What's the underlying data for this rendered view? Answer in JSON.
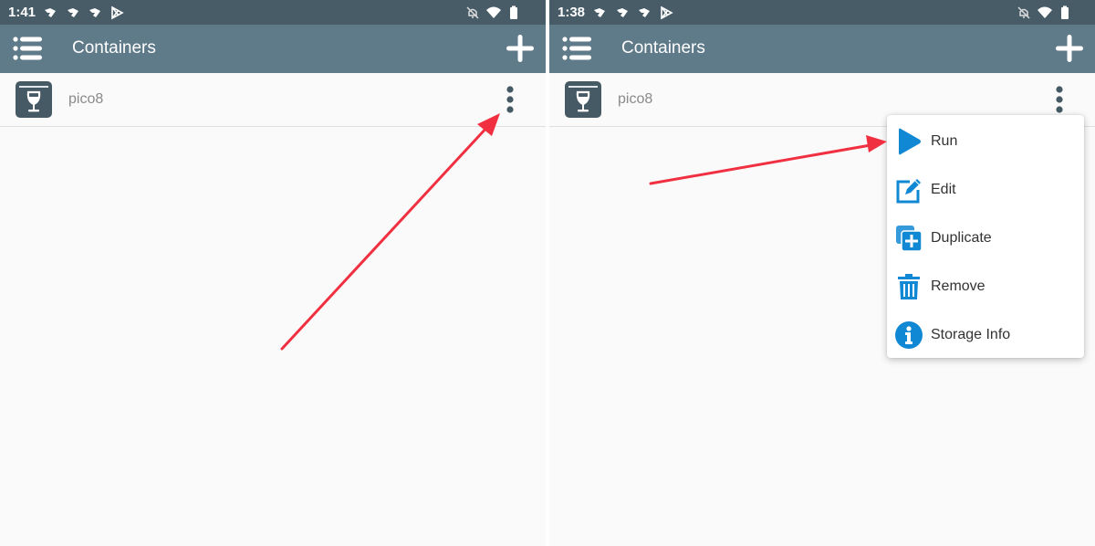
{
  "colors": {
    "statusbar": "#485c68",
    "appbar": "#5f7a88",
    "accent_blue": "#1188d4",
    "annotation_arrow": "#f03040",
    "item_icon": "#455a64"
  },
  "screens": [
    {
      "status": {
        "time": "1:41",
        "left_icons": [
          "notification-icon",
          "notification-icon",
          "notification-icon",
          "play-store-icon"
        ],
        "right_icons": [
          "mute-icon",
          "wifi-icon",
          "battery-icon"
        ]
      },
      "appbar": {
        "menu_icon": "list-menu-icon",
        "title": "Containers",
        "add_icon": "plus-icon"
      },
      "list": [
        {
          "label": "pico8",
          "icon": "wine-glass-box-icon",
          "more_icon": "more-vert-icon"
        }
      ]
    },
    {
      "status": {
        "time": "1:38",
        "left_icons": [
          "notification-icon",
          "notification-icon",
          "notification-icon",
          "play-store-icon"
        ],
        "right_icons": [
          "mute-icon",
          "wifi-icon",
          "battery-icon"
        ]
      },
      "appbar": {
        "menu_icon": "list-menu-icon",
        "title": "Containers",
        "add_icon": "plus-icon"
      },
      "list": [
        {
          "label": "pico8",
          "icon": "wine-glass-box-icon",
          "more_icon": "more-vert-icon"
        }
      ],
      "context_menu": [
        {
          "label": "Run",
          "icon": "play-icon"
        },
        {
          "label": "Edit",
          "icon": "edit-icon"
        },
        {
          "label": "Duplicate",
          "icon": "duplicate-icon"
        },
        {
          "label": "Remove",
          "icon": "trash-icon"
        },
        {
          "label": "Storage Info",
          "icon": "info-icon"
        }
      ]
    }
  ]
}
